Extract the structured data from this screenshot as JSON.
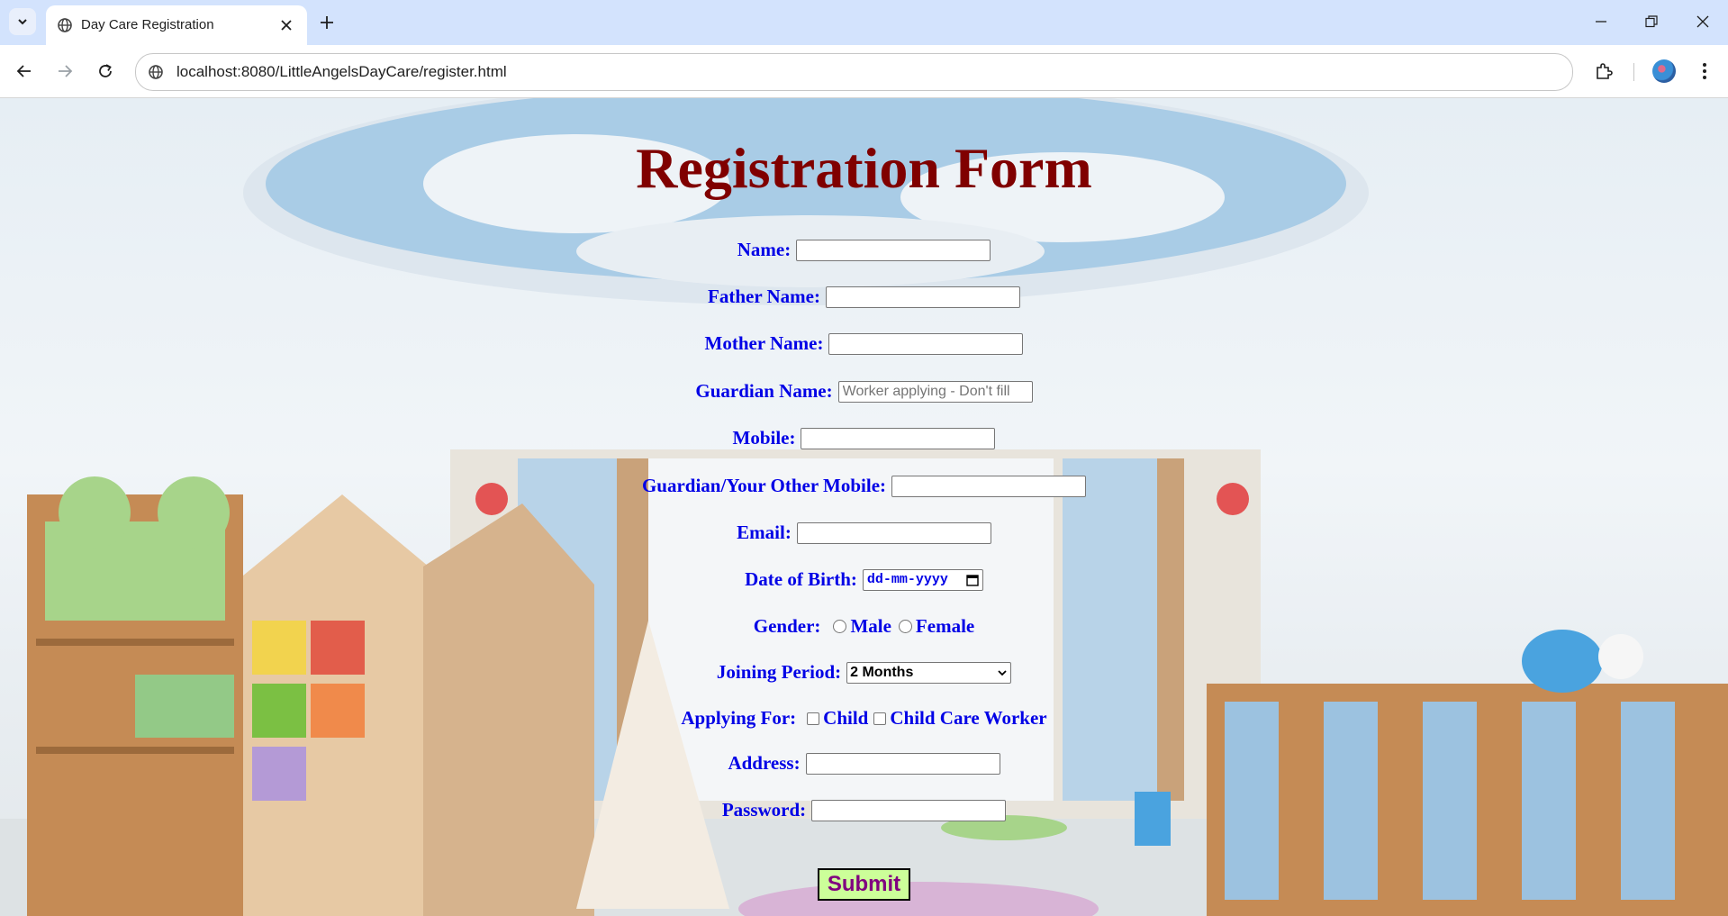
{
  "browser": {
    "tab_title": "Day Care Registration",
    "url": "localhost:8080/LittleAngelsDayCare/register.html"
  },
  "form": {
    "title": "Registration Form",
    "fields": {
      "name": {
        "label": "Name:",
        "value": ""
      },
      "father_name": {
        "label": "Father Name:",
        "value": ""
      },
      "mother_name": {
        "label": "Mother Name:",
        "value": ""
      },
      "guardian_name": {
        "label": "Guardian Name:",
        "value": "",
        "placeholder": "Worker applying - Don't fill"
      },
      "mobile": {
        "label": "Mobile:",
        "value": ""
      },
      "other_mobile": {
        "label": "Guardian/Your Other Mobile:",
        "value": ""
      },
      "email": {
        "label": "Email:",
        "value": ""
      },
      "dob": {
        "label": "Date of Birth:",
        "value": "dd-mm-yyyy"
      },
      "gender": {
        "label": "Gender:",
        "options": [
          "Male",
          "Female"
        ]
      },
      "joining_period": {
        "label": "Joining Period:",
        "selected": "2 Months"
      },
      "applying_for": {
        "label": "Applying For:",
        "options": [
          "Child",
          "Child Care Worker"
        ]
      },
      "address": {
        "label": "Address:",
        "value": ""
      },
      "password": {
        "label": "Password:",
        "value": ""
      }
    },
    "submit_label": "Submit"
  }
}
